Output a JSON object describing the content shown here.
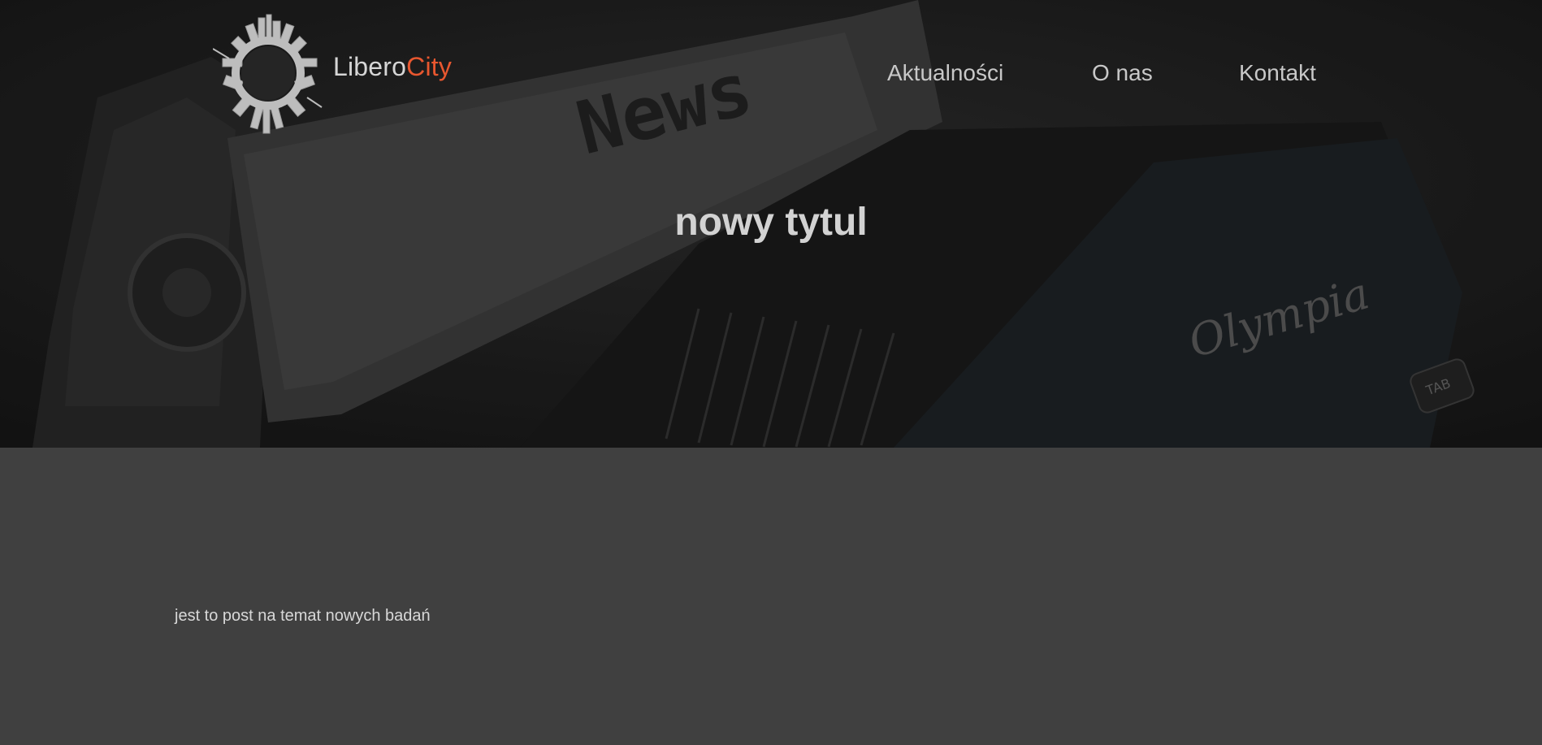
{
  "header": {
    "brand_part1": "Libero",
    "brand_part2": "City",
    "accent_color": "#e8572f",
    "logo_icon": "city-globe-icon"
  },
  "nav": {
    "items": [
      {
        "label": "Aktualności"
      },
      {
        "label": "O nas"
      },
      {
        "label": "Kontakt"
      }
    ]
  },
  "hero": {
    "title": "nowy tytul",
    "background": "typewriter-news-photo"
  },
  "post": {
    "body": "jest to post na temat nowych badań"
  }
}
